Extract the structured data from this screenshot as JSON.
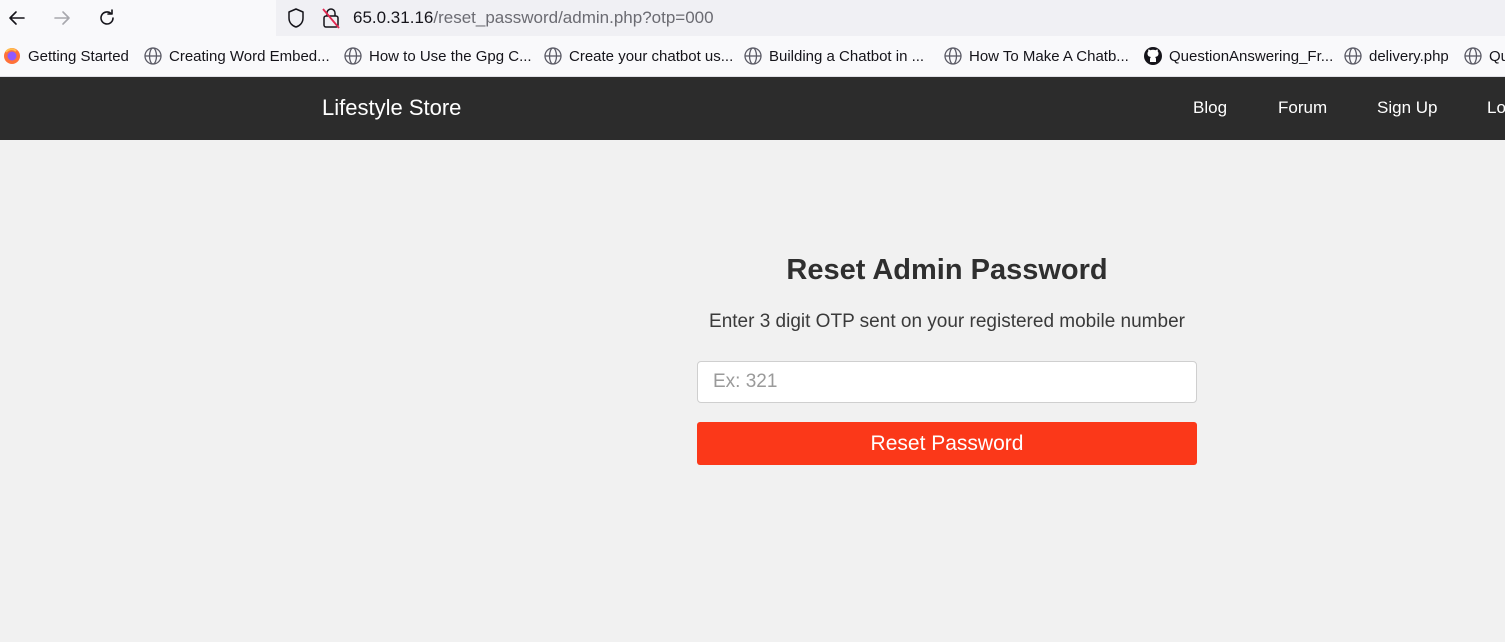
{
  "browser": {
    "url_host": "65.0.31.16",
    "url_path": "/reset_password/admin.php?otp=000",
    "bookmarks": [
      {
        "label": "Getting Started",
        "icon": "firefox-icon"
      },
      {
        "label": "Creating Word Embed...",
        "icon": "globe-icon"
      },
      {
        "label": "How to Use the Gpg C...",
        "icon": "globe-icon"
      },
      {
        "label": "Create your chatbot us...",
        "icon": "globe-icon"
      },
      {
        "label": "Building a Chatbot in ...",
        "icon": "globe-icon"
      },
      {
        "label": "How To Make A Chatb...",
        "icon": "globe-icon"
      },
      {
        "label": "QuestionAnswering_Fr...",
        "icon": "github-icon"
      },
      {
        "label": "delivery.php",
        "icon": "globe-icon"
      },
      {
        "label": "Qu",
        "icon": "globe-icon"
      }
    ]
  },
  "site": {
    "brand": "Lifestyle Store",
    "nav": [
      "Blog",
      "Forum",
      "Sign Up",
      "Lo"
    ]
  },
  "form": {
    "title": "Reset Admin Password",
    "instruction": "Enter 3 digit OTP sent on your registered mobile number",
    "otp_placeholder": "Ex: 321",
    "otp_value": "",
    "submit_label": "Reset Password"
  },
  "colors": {
    "nav_bg": "#2c2c2c",
    "button_bg": "#fb3819",
    "page_bg": "#f1f1f1"
  }
}
